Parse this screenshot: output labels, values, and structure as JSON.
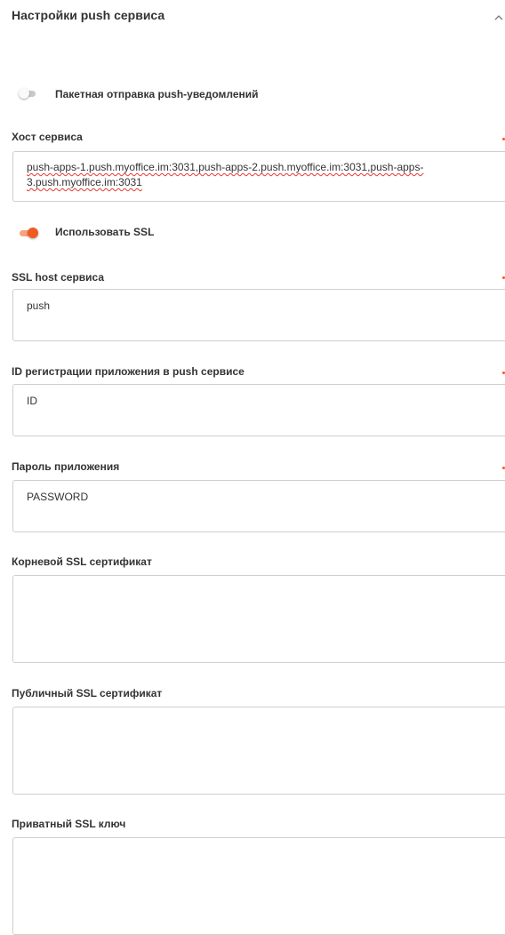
{
  "section": {
    "title": "Настройки push сервиса"
  },
  "batch_toggle": {
    "label": "Пакетная отправка push-уведомлений",
    "enabled": false
  },
  "ssl_toggle": {
    "label": "Использовать SSL",
    "enabled": true
  },
  "fields": {
    "host": {
      "label": "Хост сервиса",
      "value": "push-apps-1.push.myoffice.im:3031,push-apps-2.push.myoffice.im:3031,push-apps-3.push.myoffice.im:3031"
    },
    "ssl_host": {
      "label": "SSL host сервиса",
      "value": "push"
    },
    "app_id": {
      "label": "ID регистрации приложения в push сервисе",
      "value": "ID"
    },
    "app_password": {
      "label": "Пароль приложения",
      "value": "PASSWORD"
    },
    "root_cert": {
      "label": "Корневой SSL сертификат",
      "value": ""
    },
    "public_cert": {
      "label": "Публичный SSL сертификат",
      "value": ""
    },
    "private_key": {
      "label": "Приватный SSL ключ",
      "value": ""
    }
  },
  "colors": {
    "accent": "#f15a24",
    "toggle_off": "#c9c9c9",
    "border": "#cfcfcf"
  },
  "icons": {
    "collapse": "chevron-up-icon"
  }
}
